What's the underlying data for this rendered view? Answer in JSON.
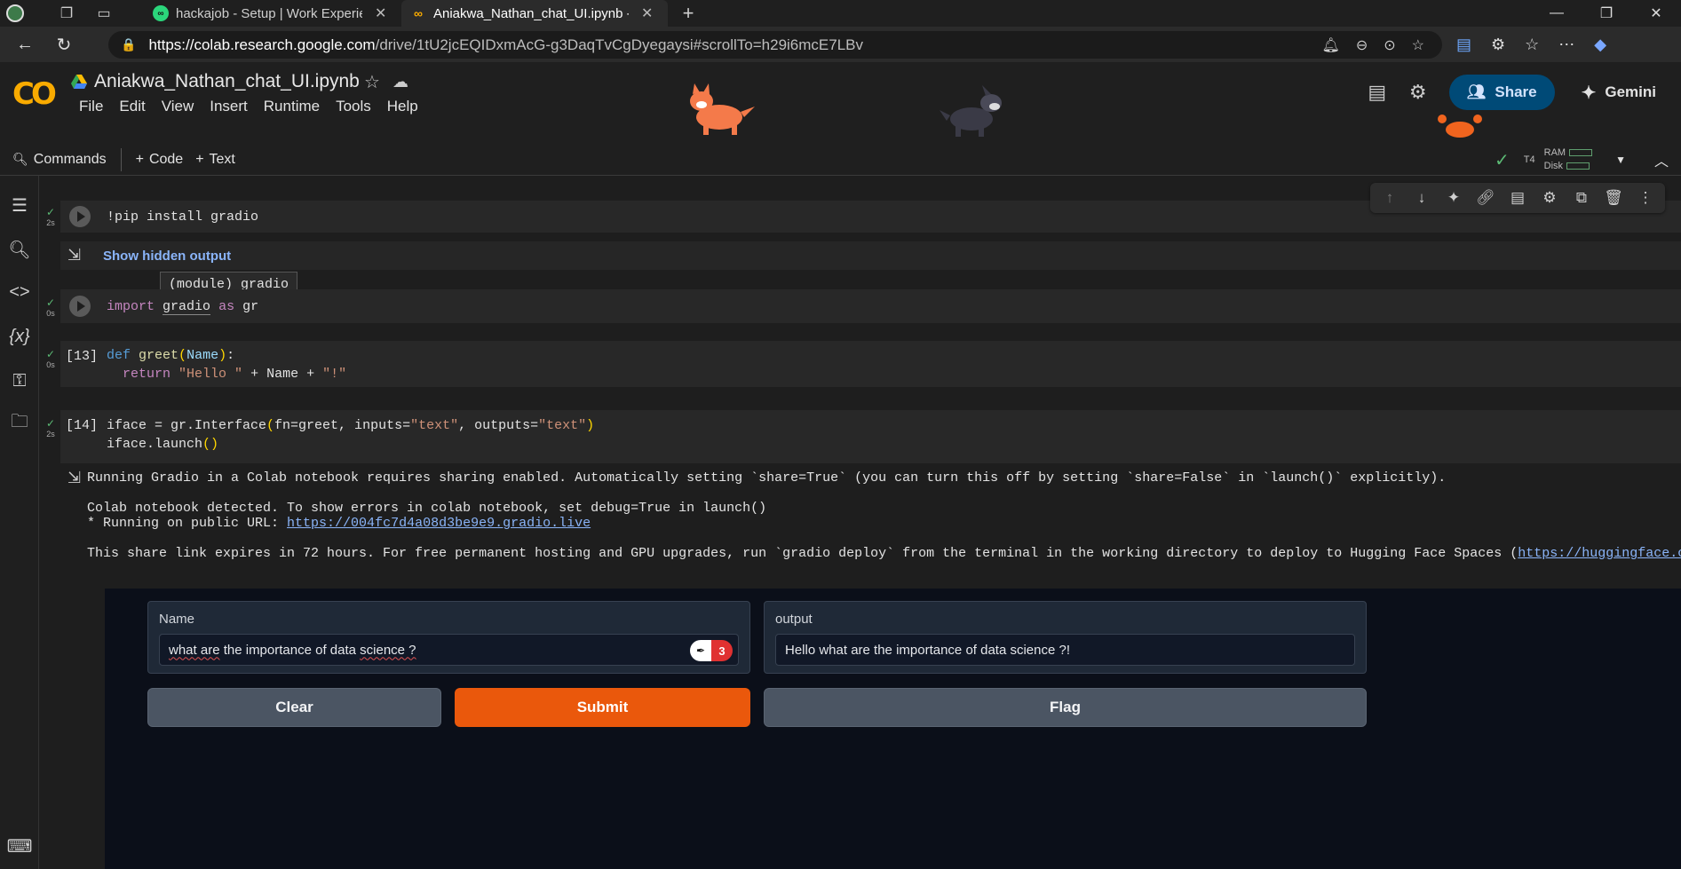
{
  "browser": {
    "tabs": [
      {
        "title": "hackajob - Setup | Work Experien",
        "favicon": "infinity-icon",
        "favicon_color": "#2bd67b",
        "active": false
      },
      {
        "title": "Aniakwa_Nathan_chat_UI.ipynb - (",
        "favicon": "colab-icon",
        "favicon_color": "#f9ab00",
        "active": true
      }
    ],
    "url_host": "https://colab.research.google.com",
    "url_path": "/drive/1tU2jcEQIDxmAcG-g3DaqTvCgDyegaysi#scrollTo=h29i6mcE7LBv"
  },
  "colab": {
    "logo": "CO",
    "notebook_title": "Aniakwa_Nathan_chat_UI.ipynb",
    "menu": [
      "File",
      "Edit",
      "View",
      "Insert",
      "Runtime",
      "Tools",
      "Help"
    ],
    "share_label": "Share",
    "gemini_label": "Gemini",
    "toolbar": {
      "commands": "Commands",
      "code": "Code",
      "text": "Text",
      "runtime_type": "T4",
      "ram": "RAM",
      "disk": "Disk"
    }
  },
  "cells": {
    "c1": {
      "time": "2s",
      "code": "!pip install gradio",
      "hidden_output": "Show hidden output"
    },
    "c2": {
      "time": "0s",
      "tooltip": "(module) gradio"
    },
    "c3": {
      "time": "0s",
      "exec": "[13]"
    },
    "c4": {
      "time": "2s",
      "exec": "[14]"
    }
  },
  "output": {
    "line1": "Running Gradio in a Colab notebook requires sharing enabled. Automatically setting `share=True` (you can turn this off by setting `share=False` in `launch()` explicitly).",
    "line2": "Colab notebook detected. To show errors in colab notebook, set debug=True in launch()",
    "line3_prefix": "* Running on public URL: ",
    "line3_link": "https://004fc7d4a08d3be9e9.gradio.live",
    "line4_prefix": "This share link expires in 72 hours. For free permanent hosting and GPU upgrades, run `gradio deploy` from the terminal in the working directory to deploy to Hugging Face Spaces (",
    "line4_link": "https://huggingface.co/spa"
  },
  "gradio": {
    "input_label": "Name",
    "input_value_parts": [
      "what are",
      " the importance of data ",
      "science ?"
    ],
    "badge_count": "3",
    "output_label": "output",
    "output_value": "Hello what are the importance of data science ?!",
    "clear_label": "Clear",
    "submit_label": "Submit",
    "flag_label": "Flag",
    "primary_color": "#ea580c"
  }
}
